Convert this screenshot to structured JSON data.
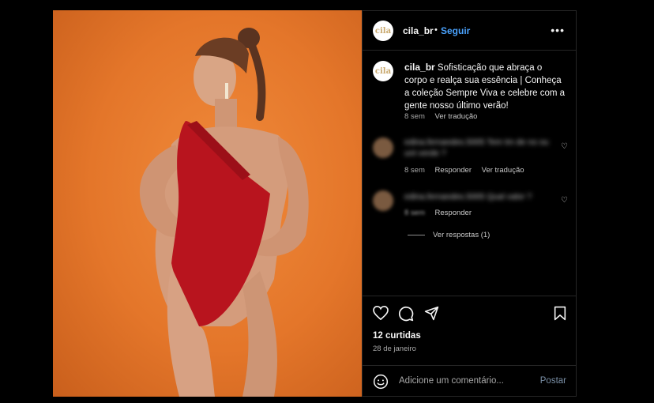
{
  "post": {
    "image_alt": "Mulher de maiô vermelho de um ombro em fundo laranja",
    "colors": {
      "background": "#e4762a",
      "swimsuit": "#b8141e"
    }
  },
  "header": {
    "avatar_text": "cila",
    "username": "cila_br",
    "separator": "•",
    "follow_label": "Seguir",
    "more_icon": "more-horizontal-icon"
  },
  "caption": {
    "username": "cila_br",
    "text": "Sofisticação que abraça o corpo e realça sua essência | Conheça a coleção Sempre Viva e celebre com a gente nosso último verão!",
    "time": "8 sem",
    "translate": "Ver tradução"
  },
  "comments": [
    {
      "text": "edina.fernandes.5005 Tem tm de no ou unt verde ?",
      "time": "8 sem",
      "reply": "Responder",
      "translate": "Ver tradução"
    },
    {
      "text": "edina.fernandes.5005 Qual valor ?",
      "time": "8 sem",
      "reply": "Responder"
    }
  ],
  "view_replies": "Ver respostas (1)",
  "likes": "12 curtidas",
  "date": "28 de janeiro",
  "comment_box": {
    "placeholder": "Adicione um comentário...",
    "post_label": "Postar"
  }
}
